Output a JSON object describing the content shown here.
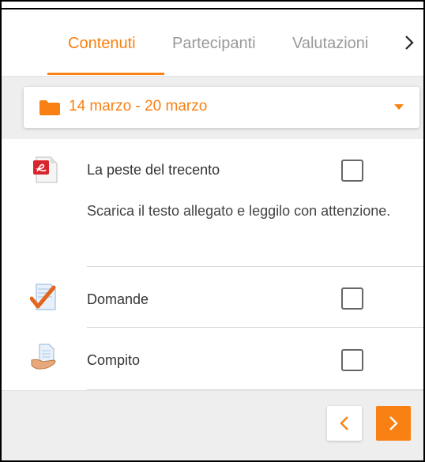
{
  "tabs": [
    {
      "label": "Contenuti",
      "active": true
    },
    {
      "label": "Partecipanti",
      "active": false
    },
    {
      "label": "Valutazioni",
      "active": false
    }
  ],
  "tabs_more_icon": "chevron-right-icon",
  "section_selector": {
    "label": "14 marzo - 20 marzo",
    "icon": "folder-icon",
    "dropdown_icon": "caret-down-icon"
  },
  "activities": [
    {
      "name": "La peste del trecento",
      "icon": "pdf-icon",
      "checked": false,
      "description": "Scarica il testo allegato e leggilo con attenzione."
    },
    {
      "name": "Domande",
      "icon": "quiz-icon",
      "checked": false
    },
    {
      "name": "Compito",
      "icon": "assignment-icon",
      "checked": false
    }
  ],
  "navigation": {
    "prev_icon": "chevron-left-icon",
    "next_icon": "chevron-right-icon"
  },
  "colors": {
    "accent": "#f98012",
    "background_gray": "#eeeeee",
    "text": "#333333",
    "muted": "#999999"
  }
}
